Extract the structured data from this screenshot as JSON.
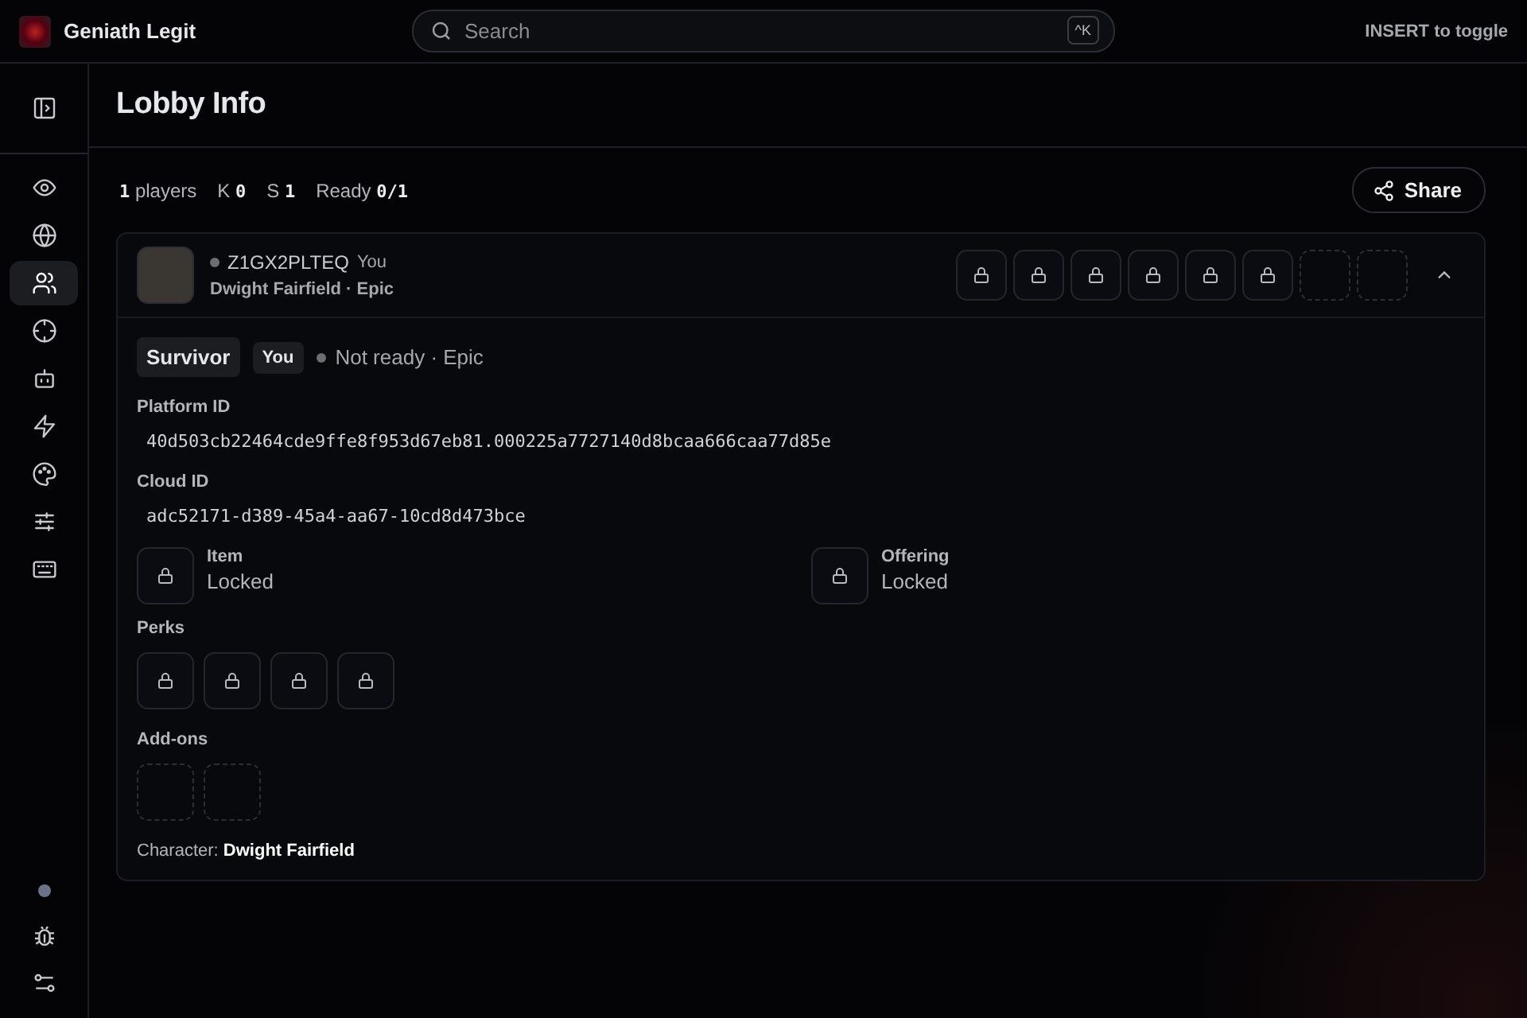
{
  "app": {
    "title": "Geniath Legit",
    "hint": "INSERT to toggle"
  },
  "search": {
    "placeholder": "Search",
    "shortcut": "^K"
  },
  "nav": [
    {
      "selected": false
    },
    {
      "selected": false
    },
    {
      "selected": true
    },
    {
      "selected": false
    },
    {
      "selected": false
    },
    {
      "selected": false
    },
    {
      "selected": false
    },
    {
      "selected": false
    },
    {
      "selected": false
    }
  ],
  "page": {
    "title": "Lobby Info",
    "share": "Share"
  },
  "stats": [
    {
      "kind": "count",
      "value": "1",
      "label": "players"
    },
    {
      "kind": "pair",
      "label": "K",
      "value": "0"
    },
    {
      "kind": "pair",
      "label": "S",
      "value": "1"
    },
    {
      "kind": "pair",
      "label": "Ready",
      "value": "0/1"
    }
  ],
  "player": {
    "name": "Z1GX2PLTEQ",
    "you": "You",
    "subtitle": "Dwight Fairfield · Epic",
    "ready": false,
    "expanded": true,
    "slots": [
      {
        "kind": "locked"
      },
      {
        "kind": "locked"
      },
      {
        "kind": "locked"
      },
      {
        "kind": "locked"
      },
      {
        "kind": "locked"
      },
      {
        "kind": "locked"
      },
      {
        "kind": "empty"
      },
      {
        "kind": "empty"
      }
    ],
    "role": "Survivor",
    "you_badge": "You",
    "status": "Not ready · Epic",
    "fields": [
      {
        "label": "Platform ID",
        "value": "40d503cb22464cde9ffe8f953d67eb81.000225a7727140d8bcaa666caa77d85e"
      },
      {
        "label": "Cloud ID",
        "value": "adc52171-d389-45a4-aa67-10cd8d473bce"
      }
    ],
    "loadout": [
      {
        "label": "Item",
        "value": "Locked",
        "kind": "locked"
      },
      {
        "label": "Offering",
        "value": "Locked",
        "kind": "locked"
      }
    ],
    "perks_label": "Perks",
    "perks": [
      {
        "kind": "locked"
      },
      {
        "kind": "locked"
      },
      {
        "kind": "locked"
      },
      {
        "kind": "locked"
      }
    ],
    "addons_label": "Add-ons",
    "addons": [
      {
        "kind": "empty"
      },
      {
        "kind": "empty"
      }
    ],
    "character": "Character: **Dwight Fairfield**"
  }
}
